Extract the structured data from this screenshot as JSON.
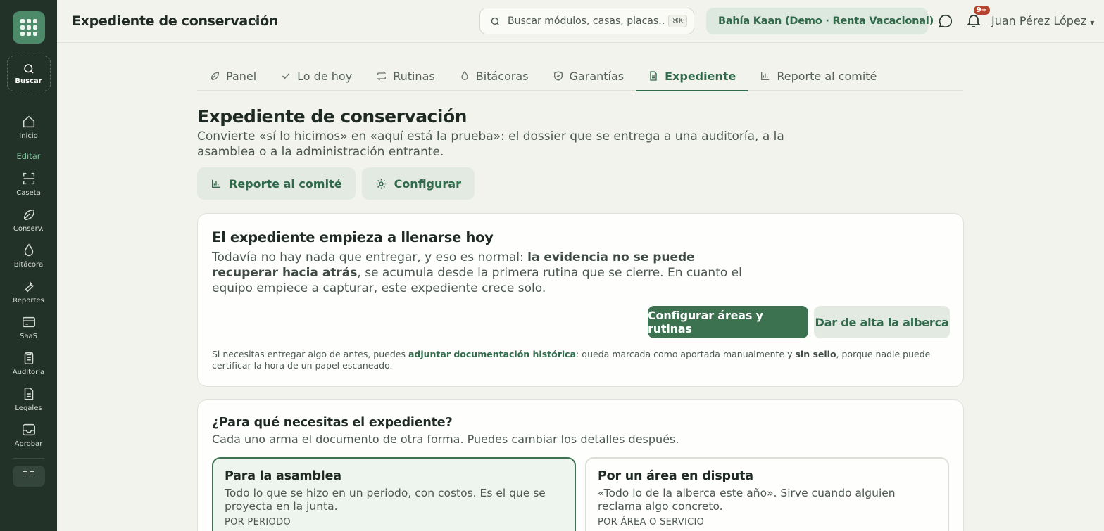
{
  "sidebar": {
    "search_label": "Buscar",
    "items_top": [
      {
        "label": "Inicio",
        "icon": "home-icon"
      }
    ],
    "section_label": "Editar",
    "items": [
      {
        "label": "Caseta",
        "icon": "scan-icon"
      },
      {
        "label": "Conserv.",
        "icon": "leaf-icon"
      },
      {
        "label": "Bitácora",
        "icon": "drop-icon"
      },
      {
        "label": "Reportes",
        "icon": "wrench-icon"
      },
      {
        "label": "SaaS",
        "icon": "card-icon"
      },
      {
        "label": "Auditoría",
        "icon": "clipboard-icon"
      },
      {
        "label": "Legales",
        "icon": "document-icon"
      },
      {
        "label": "Aprobar",
        "icon": "inbox-icon"
      }
    ]
  },
  "topbar": {
    "title": "Expediente de conservación",
    "search_placeholder": "Buscar módulos, casas, placas…",
    "search_shortcut": "⌘K",
    "org": "Bahía Kaan (Demo · Renta Vacacional)",
    "notifications": "9+",
    "user": "Juan Pérez López"
  },
  "tabs": [
    {
      "label": "Panel",
      "icon": "leaf-icon",
      "active": false
    },
    {
      "label": "Lo de hoy",
      "icon": "check-icon",
      "active": false
    },
    {
      "label": "Rutinas",
      "icon": "repeat-icon",
      "active": false
    },
    {
      "label": "Bitácoras",
      "icon": "drop-icon",
      "active": false
    },
    {
      "label": "Garantías",
      "icon": "shield-icon",
      "active": false
    },
    {
      "label": "Expediente",
      "icon": "document-icon",
      "active": true
    },
    {
      "label": "Reporte al comité",
      "icon": "bar-chart-icon",
      "active": false
    }
  ],
  "page": {
    "title": "Expediente de conservación",
    "subtitle": "Convierte «sí lo hicimos» en «aquí está la prueba»: el dossier que se entrega a una auditoría, a la asamblea o a la administración entrante.",
    "action_report": "Reporte al comité",
    "action_configure": "Configurar"
  },
  "empty_card": {
    "title": "El expediente empieza a llenarse hoy",
    "text_1": "Todavía no hay nada que entregar, y eso es normal: ",
    "text_bold": "la evidencia no se puede recuperar hacia atrás",
    "text_2": ", se acumula desde la primera rutina que se cierre. En cuanto el equipo empiece a capturar, este expediente crece solo.",
    "primary_button": "Configurar áreas y rutinas",
    "secondary_button": "Dar de alta la alberca",
    "note_1": "Si necesitas entregar algo de antes, puedes ",
    "note_link": "adjuntar documentación histórica",
    "note_2": ": queda marcada como aportada manualmente y ",
    "note_bold": "sin sello",
    "note_3": ", porque nadie puede certificar la hora de un papel escaneado."
  },
  "purpose_card": {
    "title": "¿Para qué necesitas el expediente?",
    "subtitle": "Cada uno arma el documento de otra forma. Puedes cambiar los detalles después.",
    "options": [
      {
        "title": "Para la asamblea",
        "desc": "Todo lo que se hizo en un periodo, con costos. Es el que se proyecta en la junta.",
        "kind": "POR PERIODO",
        "selected": true
      },
      {
        "title": "Por un área en disputa",
        "desc": "«Todo lo de la alberca este año». Sirve cuando alguien reclama algo concreto.",
        "kind": "POR ÁREA O SERVICIO",
        "selected": false
      }
    ]
  },
  "colors": {
    "sidebar": "#223229",
    "accent": "#3c7250",
    "accent_soft": "#e3eae2",
    "background": "#f3f3ee",
    "badge": "#b5452e"
  }
}
